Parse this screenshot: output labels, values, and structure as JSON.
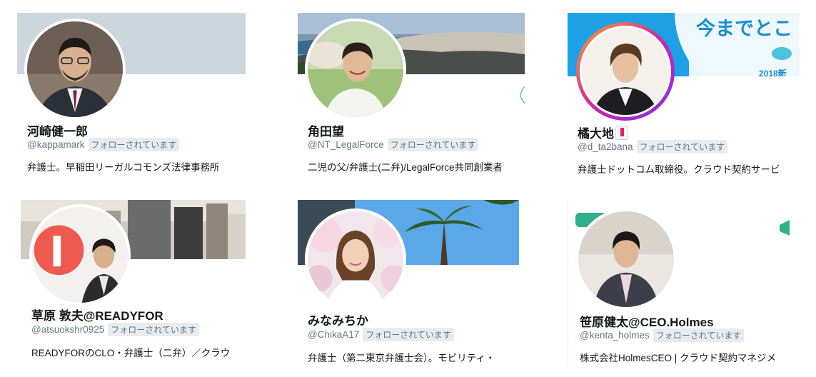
{
  "follow_badge": "フォローされています",
  "banner_text": {
    "c3_main": "今までとこ",
    "c3_sub": "2018新"
  },
  "cards": [
    {
      "name": "河崎健一郎",
      "handle": "@kappamark",
      "bio": "弁護士。早稲田リーガルコモンズ法律事務所"
    },
    {
      "name": "角田望",
      "handle": "@NT_LegalForce",
      "bio": "二児の父/弁護士(二弁)/LegalForce共同創業者"
    },
    {
      "name": "橘大地",
      "handle": "@d_ta2bana",
      "bio": "弁護士ドットコム取締役。クラウド契約サービ"
    },
    {
      "name": "草原 敦夫@READYFOR",
      "handle": "@atsuokshr0925",
      "bio": "READYFORのCLO・弁護士（二弁）／クラウ"
    },
    {
      "name": "みなみちか",
      "handle": "@ChikaA17",
      "bio": "弁護士（第二東京弁護士会）。モビリティ・"
    },
    {
      "name": "笹原健太@CEO.Holmes",
      "handle": "@kenta_holmes",
      "bio": "株式会社HolmesCEO | クラウド契約マネジメ"
    }
  ],
  "colors": {
    "badge_bg": "#e6ecf0",
    "handle_gray": "#657786",
    "accent_blue": "#1da1f2"
  }
}
